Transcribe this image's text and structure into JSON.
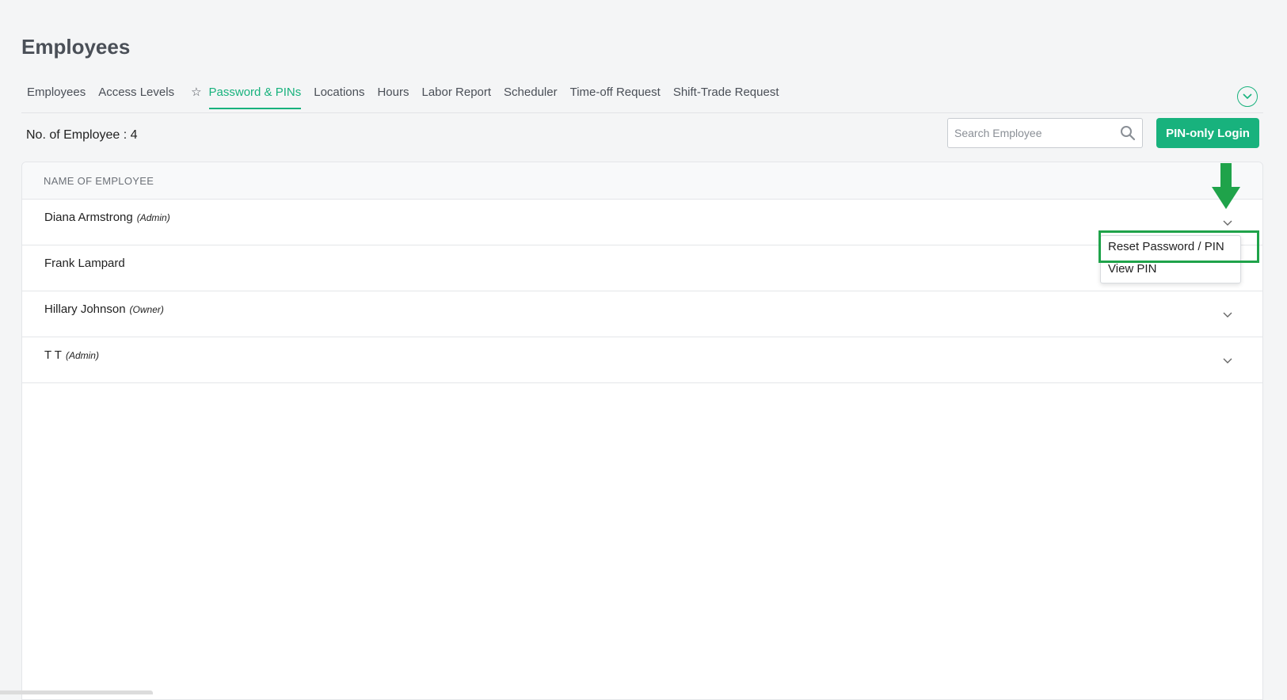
{
  "page": {
    "title": "Employees"
  },
  "tabs": [
    {
      "label": "Employees",
      "active": false
    },
    {
      "label": "Access Levels",
      "active": false
    },
    {
      "label": "Password & PINs",
      "active": true,
      "starred": true
    },
    {
      "label": "Locations",
      "active": false
    },
    {
      "label": "Hours",
      "active": false
    },
    {
      "label": "Labor Report",
      "active": false
    },
    {
      "label": "Scheduler",
      "active": false
    },
    {
      "label": "Time-off Request",
      "active": false
    },
    {
      "label": "Shift-Trade Request",
      "active": false
    }
  ],
  "toolbar": {
    "count_text": "No. of Employee : 4",
    "search_placeholder": "Search Employee",
    "pin_login_label": "PIN-only Login"
  },
  "table": {
    "header": "NAME OF EMPLOYEE",
    "rows": [
      {
        "name": "Diana Armstrong",
        "role": "(Admin)"
      },
      {
        "name": "Frank Lampard",
        "role": ""
      },
      {
        "name": "Hillary Johnson",
        "role": "(Owner)"
      },
      {
        "name": "T T",
        "role": "(Admin)"
      }
    ]
  },
  "dropdown": {
    "items": [
      "Reset Password / PIN",
      "View PIN"
    ]
  },
  "colors": {
    "accent": "#18b27d",
    "highlight": "#1fa34a",
    "background": "#f4f5f6"
  },
  "icons": [
    "star-icon",
    "collapse-chevron-icon",
    "search-icon",
    "chevron-down-icon",
    "down-arrow-icon"
  ]
}
